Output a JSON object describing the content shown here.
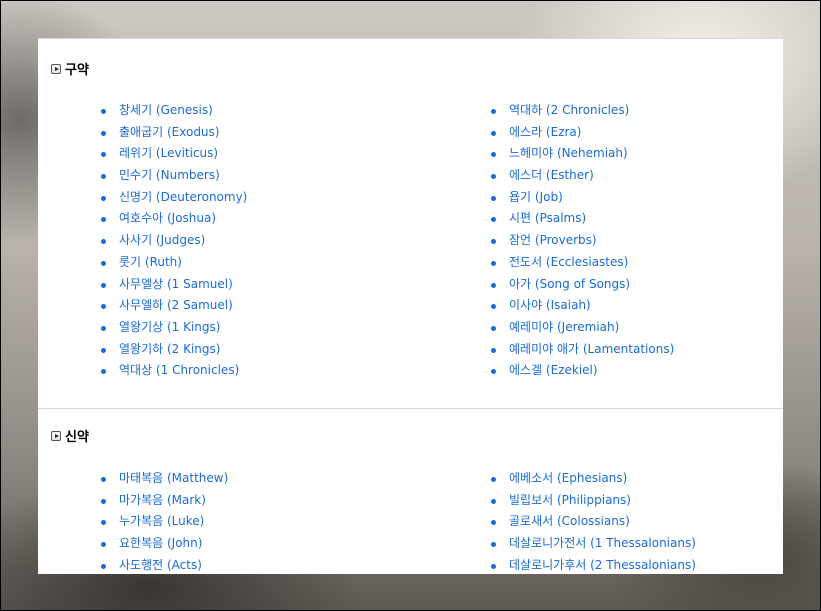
{
  "old_testament": {
    "title": "구약",
    "left": [
      "창세기 (Genesis)",
      "출애굽기 (Exodus)",
      "레위기 (Leviticus)",
      "민수기 (Numbers)",
      "신명기 (Deuteronomy)",
      "여호수아 (Joshua)",
      "사사기 (Judges)",
      "룻기 (Ruth)",
      "사무엘상 (1 Samuel)",
      "사무엘하 (2 Samuel)",
      "열왕기상 (1 Kings)",
      "열왕기하 (2 Kings)",
      "역대상 (1 Chronicles)"
    ],
    "right": [
      "역대하 (2 Chronicles)",
      "에스라 (Ezra)",
      "느헤미야 (Nehemiah)",
      "에스더 (Esther)",
      "욥기 (Job)",
      "시편 (Psalms)",
      "잠언 (Proverbs)",
      "전도서 (Ecclesiastes)",
      "아가 (Song of Songs)",
      "이사야 (Isaiah)",
      "예레미야 (Jeremiah)",
      "예레미야 애가 (Lamentations)",
      "에스겔 (Ezekiel)"
    ]
  },
  "new_testament": {
    "title": "신약",
    "left": [
      "마태복음 (Matthew)",
      "마가복음 (Mark)",
      "누가복음 (Luke)",
      "요한복음 (John)",
      "사도행전 (Acts)"
    ],
    "right": [
      "에베소서 (Ephesians)",
      "빌립보서 (Philippians)",
      "골로새서 (Colossians)",
      "데살로니가전서 (1 Thessalonians)",
      "데살로니가후서 (2 Thessalonians)"
    ]
  },
  "icons": {
    "section_toggle": "expand-arrow-icon"
  },
  "colors": {
    "link": "#1a6bd4",
    "panel_background": "#ffffff"
  }
}
